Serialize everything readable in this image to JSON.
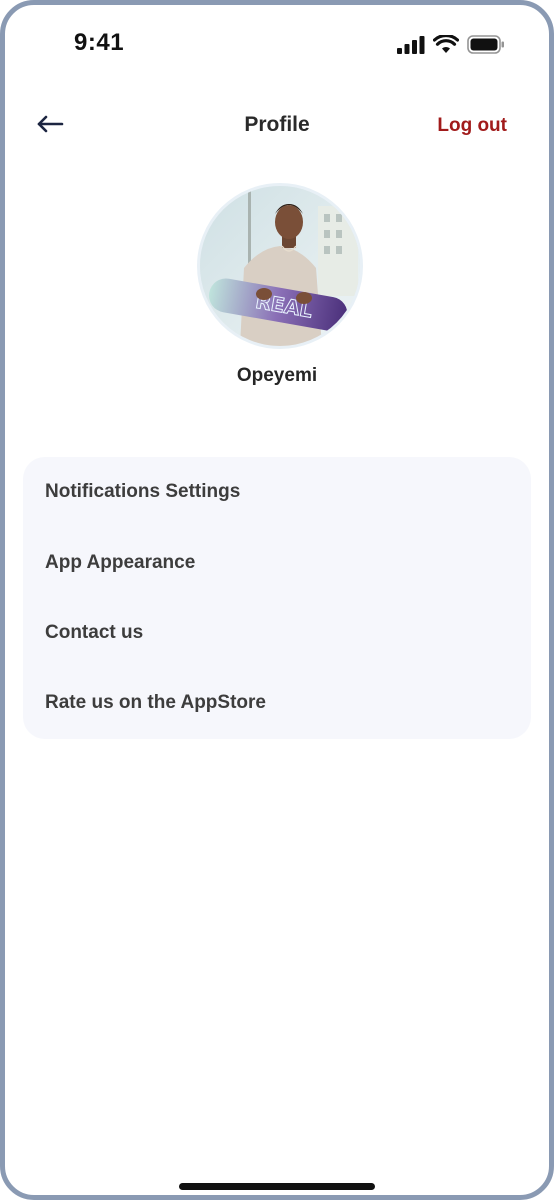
{
  "status_bar": {
    "time": "9:41",
    "icons": [
      "signal-icon",
      "wifi-icon",
      "battery-icon"
    ]
  },
  "header": {
    "back_icon": "arrow-left-icon",
    "title": "Profile",
    "logout_label": "Log out"
  },
  "profile": {
    "name": "Opeyemi"
  },
  "settings": {
    "items": [
      {
        "label": "Notifications Settings"
      },
      {
        "label": "App Appearance"
      },
      {
        "label": "Contact us"
      },
      {
        "label": "Rate us on the AppStore"
      }
    ]
  },
  "colors": {
    "accent_logout": "#a11b1b",
    "card_background": "#f6f7fc",
    "frame_border": "#8a9ab3"
  }
}
